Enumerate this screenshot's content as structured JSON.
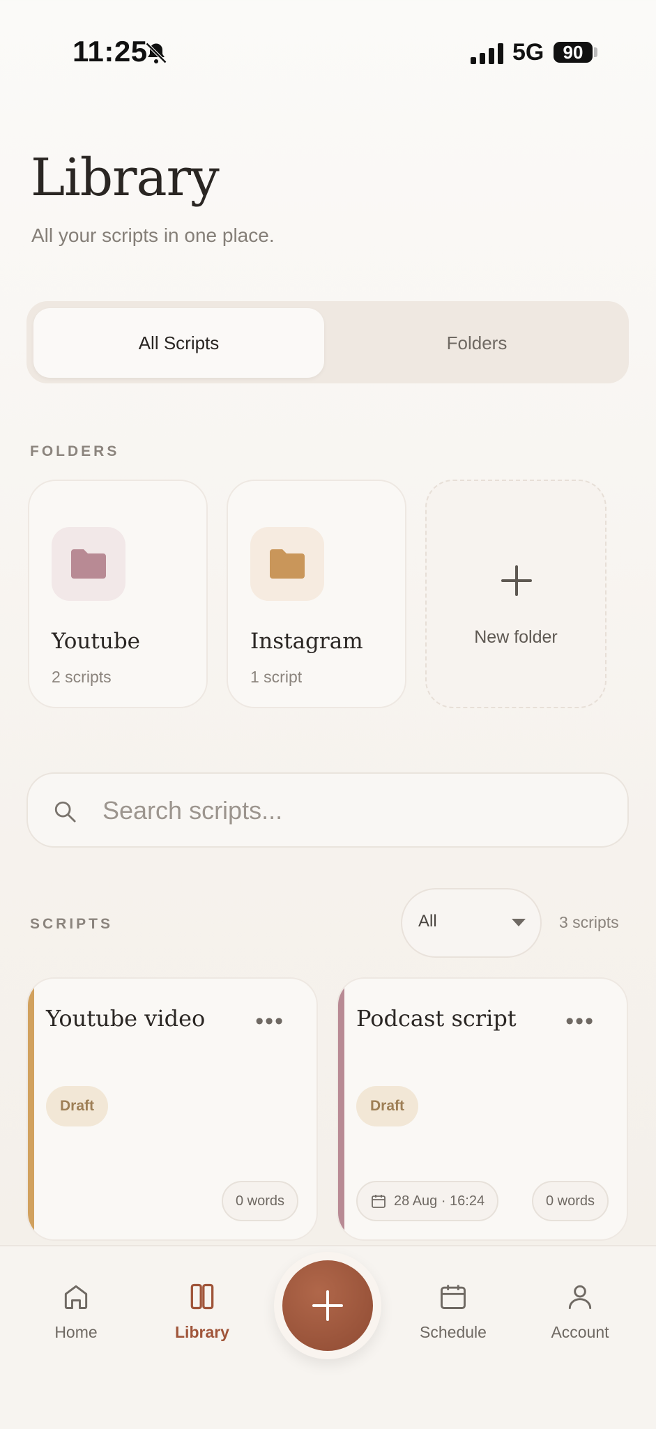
{
  "status_bar": {
    "time": "11:25",
    "network": "5G",
    "battery": "90",
    "icons": [
      "bell-slash-icon",
      "signal-icon",
      "battery-icon"
    ]
  },
  "header": {
    "title": "Library",
    "subtitle": "All your scripts in one place."
  },
  "tabs": [
    {
      "label": "All Scripts",
      "active": true
    },
    {
      "label": "Folders",
      "active": false
    }
  ],
  "folders_section": {
    "label": "FOLDERS",
    "items": [
      {
        "name": "Youtube",
        "count": "2 scripts",
        "color": "#b88a94",
        "bg": "#f2e8e8"
      },
      {
        "name": "Instagram",
        "count": "1 script",
        "color": "#c9965a",
        "bg": "#f6ebe0"
      }
    ],
    "new_folder_label": "New folder"
  },
  "search": {
    "placeholder": "Search scripts..."
  },
  "scripts_section": {
    "label": "SCRIPTS",
    "filter_value": "All",
    "count": "3 scripts",
    "items": [
      {
        "title": "Youtube video",
        "status": "Draft",
        "words": "0 words",
        "accent": "#d1a15e"
      },
      {
        "title": "Podcast script",
        "status": "Draft",
        "date": "28 Aug · 16:24",
        "words": "0 words",
        "accent": "#b88a94"
      }
    ]
  },
  "bottom_nav": {
    "items": [
      {
        "label": "Home",
        "icon": "home-icon"
      },
      {
        "label": "Library",
        "icon": "library-icon",
        "active": true
      },
      {
        "label": "Schedule",
        "icon": "calendar-icon"
      },
      {
        "label": "Account",
        "icon": "user-icon"
      }
    ],
    "fab_icon": "plus-icon"
  },
  "colors": {
    "accent": "#a0553a",
    "text": "#2a2623",
    "muted": "#8b847d"
  }
}
